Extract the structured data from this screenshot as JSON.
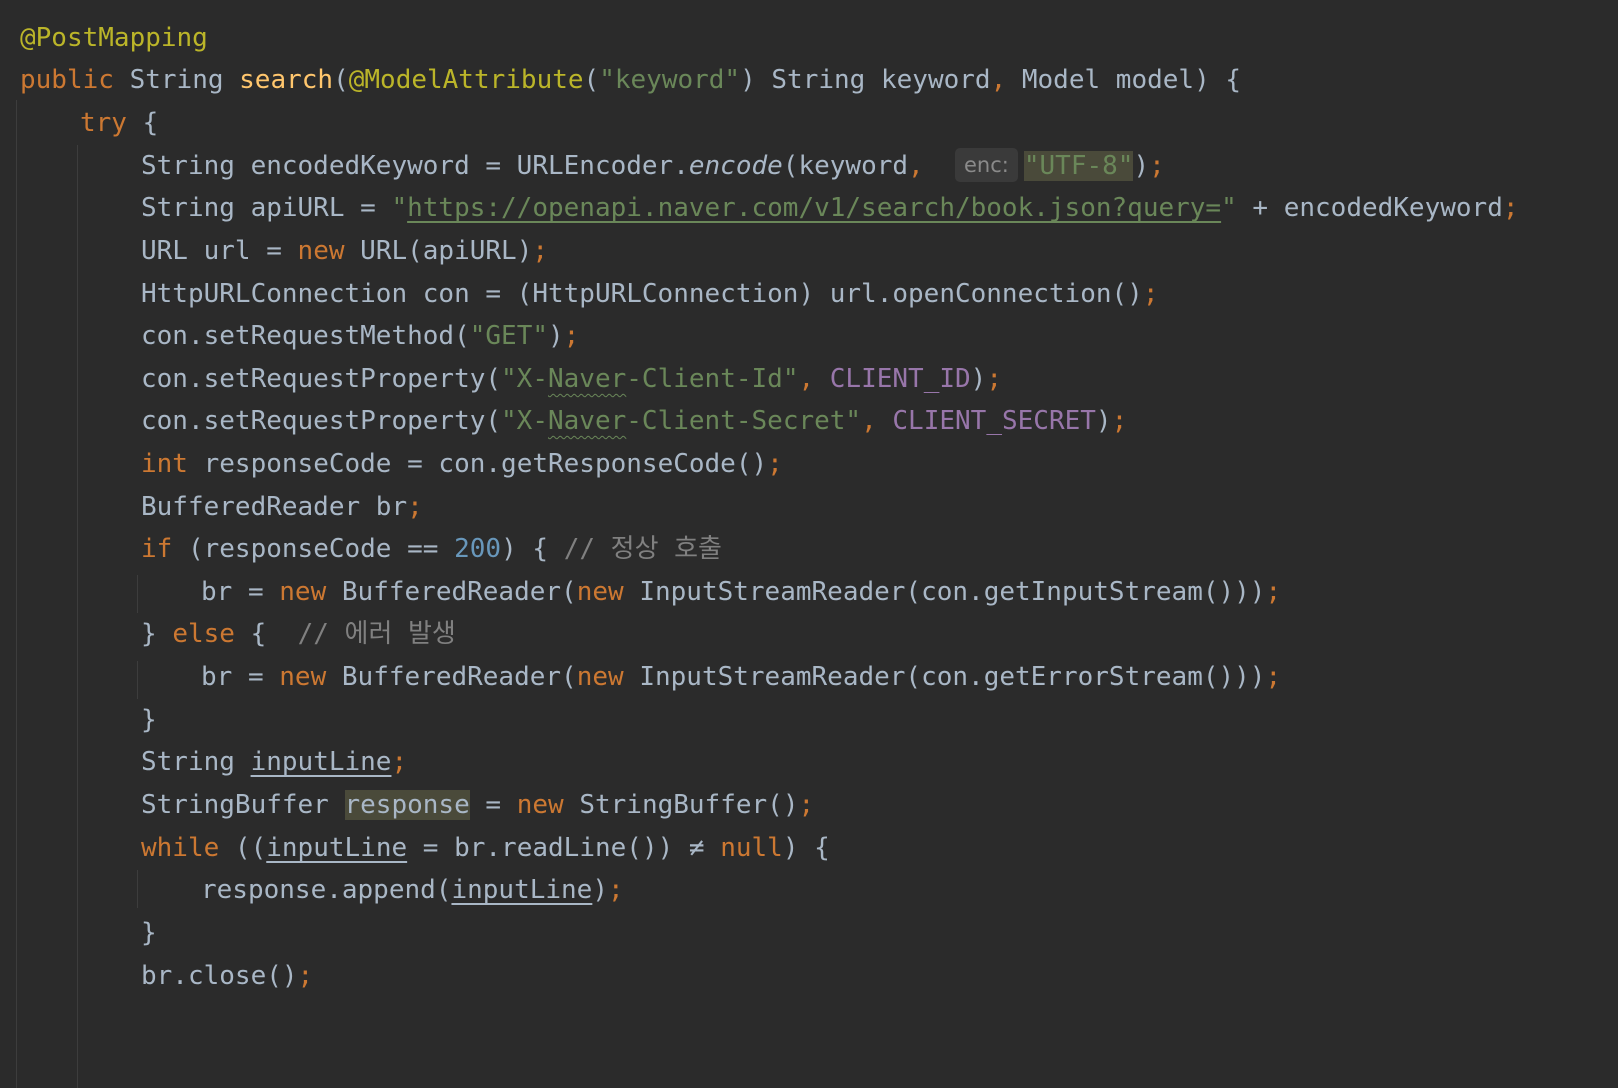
{
  "editor": {
    "language": "java",
    "theme_colors": {
      "background": "#2b2b2b",
      "keyword": "#cc7832",
      "string": "#6a8759",
      "annotation": "#bbb529",
      "method_declaration": "#ffc66d",
      "number": "#6897bb",
      "constant": "#9876aa",
      "comment": "#808080",
      "identifier": "#a9b7c6"
    },
    "inlay_hint": "enc:",
    "code": {
      "annotation_post": "@PostMapping",
      "kw_public": "public",
      "type_string": "String",
      "method_name": "search",
      "annotation_model": "@ModelAttribute",
      "str_keyword": "\"keyword\"",
      "param_keyword": "String keyword",
      "param_model": "Model model",
      "kw_try": "try",
      "l4_a": "String encodedKeyword = URLEncoder.",
      "l4_encode": "encode",
      "l4_b": "(keyword",
      "l4_utf8": "\"UTF-8\"",
      "l5_a": "String apiURL = ",
      "l5_quote_open": "\"",
      "l5_url": "https://openapi.naver.com/v1/search/book.json?query=",
      "l5_quote_close": "\"",
      "l5_b": " + encodedKeyword",
      "l6_a": "URL url = ",
      "kw_new": "new",
      "l6_b": " URL(apiURL)",
      "l7": "HttpURLConnection con = (HttpURLConnection) url.openConnection()",
      "l8_a": "con.setRequestMethod(",
      "l8_get": "\"GET\"",
      "l9_a": "con.setRequestProperty(",
      "str_x": "\"X-",
      "str_naver": "Naver",
      "l9_str_end": "-Client-Id\"",
      "const_client_id": "CLIENT_ID",
      "l10_str_end": "-Client-Secret\"",
      "const_client_secret": "CLIENT_SECRET",
      "kw_int": "int",
      "l11_b": " responseCode = con.getResponseCode()",
      "l12": "BufferedReader br",
      "kw_if": "if",
      "l13_a": " (responseCode ",
      "op_eq": "==",
      "num_200": "200",
      "l13_b": ") { ",
      "cmt_ok": "// 정상 호출",
      "l14_a": "br = ",
      "l14_b": " BufferedReader(",
      "l14_c": " InputStreamReader(con.getInputStream()))",
      "l15_a": "} ",
      "kw_else": "else",
      "l15_b": " {  ",
      "cmt_err": "// 에러 발생",
      "l16_c": " InputStreamReader(con.getErrorStream()))",
      "brace_close": "}",
      "l18_a": "String ",
      "var_inputline": "inputLine",
      "l19_a": "StringBuffer ",
      "var_response": "response",
      "l19_b": " = ",
      "l19_c": " StringBuffer()",
      "kw_while": "while",
      "l20_a": " ((",
      "l20_b": " = br.readLine()) ",
      "op_ne": "≠",
      "kw_null": "null",
      "l20_c": ") {",
      "l21_a": "response.append(",
      "l21_b": ")",
      "l23": "br.close()",
      "semi": ";",
      "comma": ",",
      "paren_open": "(",
      "paren_close": ")",
      "brace_open": "{"
    }
  }
}
